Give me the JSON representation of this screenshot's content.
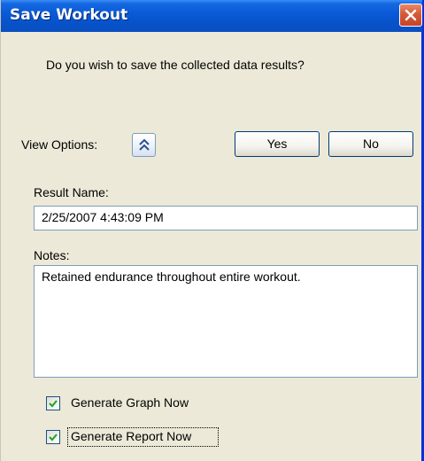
{
  "window": {
    "title": "Save Workout",
    "close_icon": "close-icon",
    "accent_color": "#0a5ad8",
    "close_color": "#d65a36"
  },
  "dialog": {
    "prompt": "Do you wish to save the collected data results?",
    "view_options_label": "View Options:",
    "view_options_icon": "double-chevron-up-icon",
    "yes_label": "Yes",
    "no_label": "No",
    "result_name_label": "Result Name:",
    "result_name_value": "2/25/2007 4:43:09 PM",
    "notes_label": "Notes:",
    "notes_value": "Retained endurance throughout entire workout.",
    "checkboxes": [
      {
        "label": "Generate Graph Now",
        "checked": true
      },
      {
        "label": "Generate Report Now",
        "checked": true,
        "focused": true
      }
    ]
  }
}
